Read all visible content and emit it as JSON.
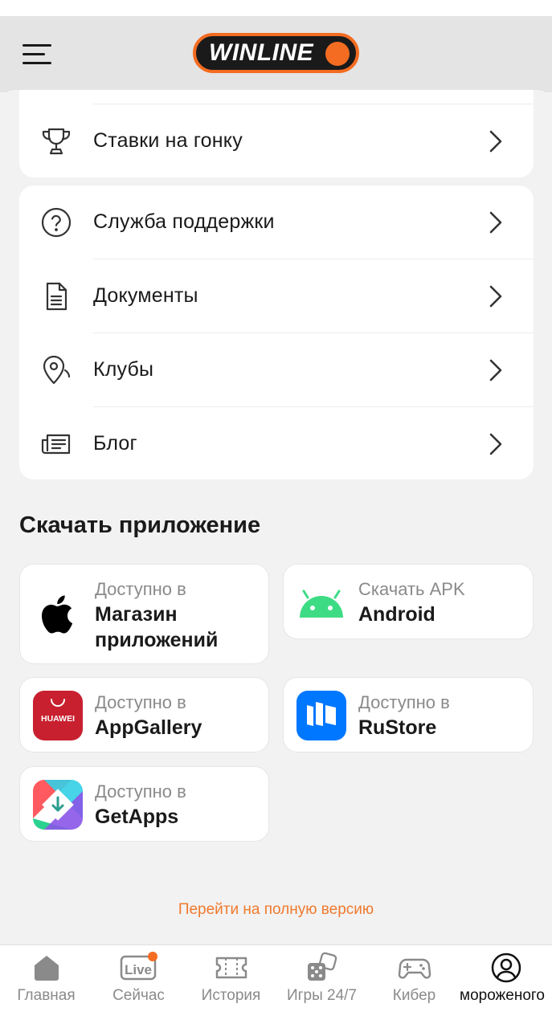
{
  "header": {
    "logo_text": "WINLINE",
    "brand_color": "#f36c21"
  },
  "menu_top": [
    {
      "label": "Ставки на гонку",
      "icon": "trophy-icon"
    }
  ],
  "menu_main": [
    {
      "label": "Служба поддержки",
      "icon": "help-circle-icon"
    },
    {
      "label": "Документы",
      "icon": "document-icon"
    },
    {
      "label": "Клубы",
      "icon": "map-pin-icon"
    },
    {
      "label": "Блог",
      "icon": "newspaper-icon"
    }
  ],
  "download": {
    "title": "Скачать приложение",
    "apps": [
      {
        "sub": "Доступно в",
        "title_line1": "Магазин",
        "title_line2": "приложений",
        "icon": "apple-icon"
      },
      {
        "sub": "Скачать APK",
        "title": "Android",
        "icon": "android-icon"
      },
      {
        "sub": "Доступно в",
        "title": "AppGallery",
        "icon": "huawei-icon",
        "icon_text": "HUAWEI"
      },
      {
        "sub": "Доступно в",
        "title": "RuStore",
        "icon": "rustore-icon"
      },
      {
        "sub": "Доступно в",
        "title": "GetApps",
        "icon": "getapps-icon"
      }
    ]
  },
  "full_version_link": "Перейти на полную версию",
  "tabbar": [
    {
      "label": "Главная",
      "icon": "home-icon"
    },
    {
      "label": "Сейчас",
      "icon": "live-icon",
      "icon_text": "Live"
    },
    {
      "label": "История",
      "icon": "ticket-icon"
    },
    {
      "label": "Игры 24/7",
      "icon": "dice-icon"
    },
    {
      "label": "Кибер",
      "icon": "gamepad-icon"
    },
    {
      "label": "мороженого",
      "icon": "profile-icon",
      "active": true
    }
  ]
}
